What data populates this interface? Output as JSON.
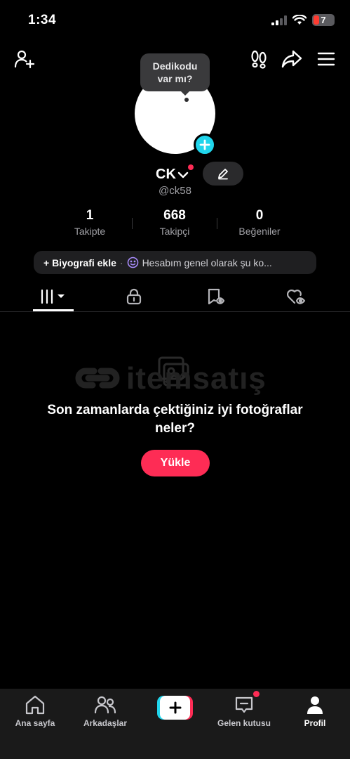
{
  "status_bar": {
    "time": "1:34",
    "battery_level": "7"
  },
  "tooltip": {
    "text": "Dedikodu var mı?"
  },
  "profile": {
    "display_name": "CK",
    "username": "@ck58"
  },
  "stats": [
    {
      "value": "1",
      "label": "Takipte"
    },
    {
      "value": "668",
      "label": "Takipçi"
    },
    {
      "value": "0",
      "label": "Beğeniler"
    }
  ],
  "bio": {
    "add_label": "+ Biyografi ekle",
    "separator": "·",
    "text": "Hesabım genel olarak şu ko..."
  },
  "tabs": [
    {
      "icon": "grid-icon",
      "active": true
    },
    {
      "icon": "lock-icon",
      "active": false
    },
    {
      "icon": "bookmark-icon",
      "active": false
    },
    {
      "icon": "liked-icon",
      "active": false
    }
  ],
  "watermark": {
    "text": "itemsatış"
  },
  "empty_state": {
    "title": "Son zamanlarda çektiğiniz iyi fotoğraflar neler?",
    "button_label": "Yükle"
  },
  "bottom_nav": {
    "home": "Ana sayfa",
    "friends": "Arkadaşlar",
    "inbox": "Gelen kutusu",
    "profile": "Profil"
  },
  "colors": {
    "accent": "#fe2c55",
    "cyan": "#20d5ec",
    "background": "#000000"
  }
}
